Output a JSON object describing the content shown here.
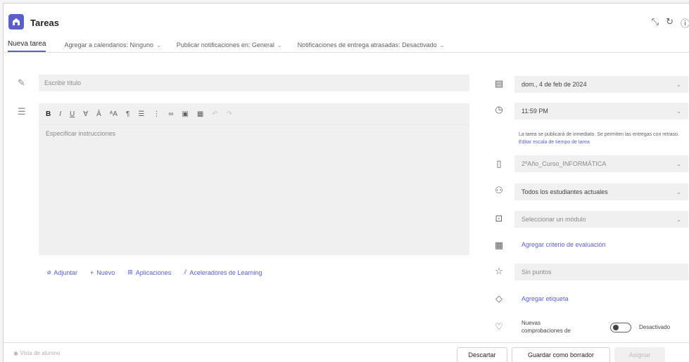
{
  "app": {
    "title": "Tareas"
  },
  "toolbar": {
    "new_task": "Nueva tarea",
    "calendar": "Agregar a calendarios: Ninguno",
    "notifications": "Publicar notificaciones en: General",
    "late_notifications": "Notificaciones de entrega atrasadas: Desactivado"
  },
  "editor": {
    "title_placeholder": "Escribir título",
    "instructions_placeholder": "Especificar instrucciones"
  },
  "attach": {
    "attach": "Adjuntar",
    "new": "Nuevo",
    "apps": "Aplicaciones",
    "learning": "Aceleradores de Learning"
  },
  "schedule": {
    "date": "dom., 4 de feb de 2024",
    "time": "11:59 PM",
    "note": "La tarea se publicará de inmediato. Se permiten las entregas con retraso.",
    "note_link": "Editar escala de tiempo de tarea"
  },
  "assign": {
    "class": "2ºAño_Curso_INFORMÁTICA",
    "students": "Todos los estudiantes actuales",
    "module_placeholder": "Seleccionar un módulo"
  },
  "grading": {
    "rubric_link": "Agregar criterio de evaluación",
    "points_placeholder": "Sin puntos",
    "tag_link": "Agregar etiqueta"
  },
  "checks": {
    "label": "Nuevas comprobaciones de",
    "state": "Desactivado"
  },
  "footer": {
    "preview": "Vista de alumno",
    "discard": "Descartar",
    "save_draft": "Guardar como borrador",
    "assign": "Asignar"
  },
  "colors": {
    "accent": "#5b5fc7",
    "field_bg": "#f0f0f0"
  }
}
